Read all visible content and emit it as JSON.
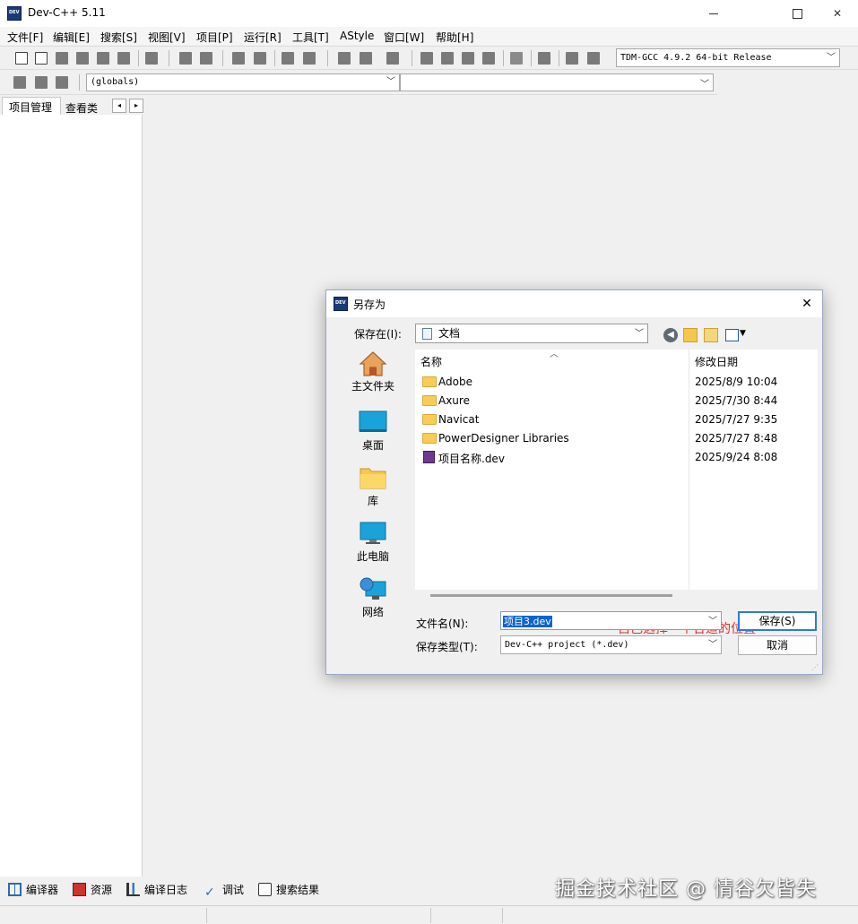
{
  "app": {
    "title": "Dev-C++ 5.11"
  },
  "menu": [
    "文件[F]",
    "编辑[E]",
    "搜索[S]",
    "视图[V]",
    "项目[P]",
    "运行[R]",
    "工具[T]",
    "AStyle",
    "窗口[W]",
    "帮助[H]"
  ],
  "toolbar": {
    "compiler": "TDM-GCC 4.9.2 64-bit Release",
    "scope": "(globals)",
    "member": ""
  },
  "left_panel": {
    "tab_project": "项目管理",
    "tab_classes": "查看类",
    "scroll_left": "◂",
    "scroll_right": "▸"
  },
  "bottom_tabs": [
    "编译器",
    "资源",
    "编译日志",
    "调试",
    "搜索结果"
  ],
  "watermark": "掘金技术社区 @ 情谷欠皆失",
  "dialog": {
    "title": "另存为",
    "close": "✕",
    "save_in_label": "保存在(I):",
    "save_in_value": "文档",
    "places": [
      "主文件夹",
      "桌面",
      "库",
      "此电脑",
      "网络"
    ],
    "columns": {
      "name": "名称",
      "date": "修改日期"
    },
    "files": [
      {
        "name": "Adobe",
        "date": "2025/8/9 10:04",
        "kind": "folder"
      },
      {
        "name": "Axure",
        "date": "2025/7/30 8:44",
        "kind": "folder"
      },
      {
        "name": "Navicat",
        "date": "2025/7/27 9:35",
        "kind": "folder"
      },
      {
        "name": "PowerDesigner Libraries",
        "date": "2025/7/27 8:48",
        "kind": "folder"
      },
      {
        "name": "项目名称.dev",
        "date": "2025/9/24 8:08",
        "kind": "dev-file"
      }
    ],
    "annotation": "自己选择一个合适的位置",
    "filename_label": "文件名(N):",
    "filename_value": "项目3.dev",
    "filetype_label": "保存类型(T):",
    "filetype_value": "Dev-C++ project (*.dev)",
    "save_button": "保存(S)",
    "cancel_button": "取消"
  },
  "colors": {
    "annotation": "#d93030",
    "selection": "#0a64d2",
    "default_button_border": "#2d7ad6"
  }
}
